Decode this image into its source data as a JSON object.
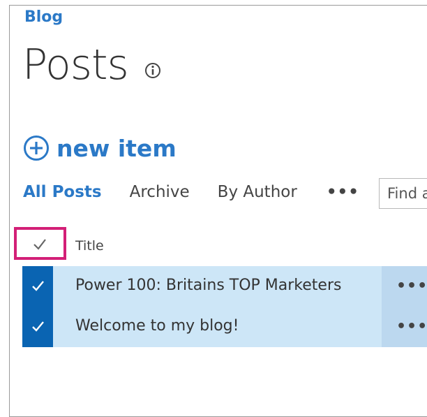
{
  "breadcrumb": {
    "label": "Blog"
  },
  "page": {
    "title": "Posts",
    "info_icon": "info-icon"
  },
  "toolbar": {
    "new_item_label": "new item",
    "new_item_icon": "circle-plus-icon"
  },
  "views": {
    "items": [
      {
        "label": "All Posts",
        "active": true
      },
      {
        "label": "Archive",
        "active": false
      },
      {
        "label": "By Author",
        "active": false
      }
    ],
    "more_label": "•••"
  },
  "search": {
    "placeholder": "Find a"
  },
  "list": {
    "columns": {
      "title": "Title"
    },
    "select_all_icon": "checkmark-icon",
    "highlight_color": "#d31f77",
    "rows": [
      {
        "title": "Power 100: Britains TOP Marketers",
        "selected": true,
        "menu_label": "•••"
      },
      {
        "title": "Welcome to my blog!",
        "selected": true,
        "menu_label": "•••"
      }
    ]
  },
  "colors": {
    "accent": "#2b79c7",
    "selected_row": "#cde6f7",
    "selected_marker": "#0a64b2"
  }
}
